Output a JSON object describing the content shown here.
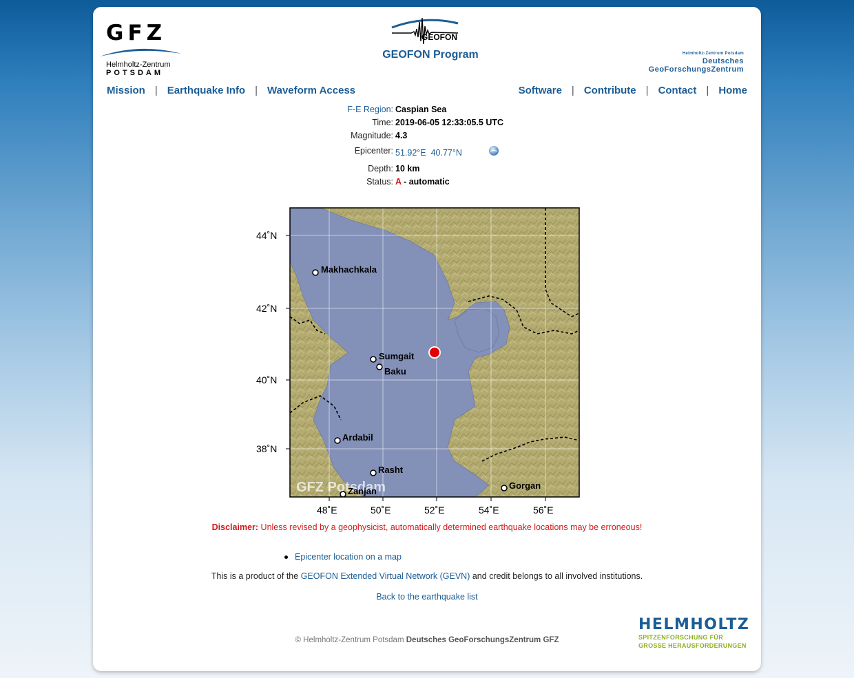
{
  "header": {
    "gfz_letters": "GFZ",
    "gfz_sub1": "Helmholtz-Zentrum",
    "gfz_sub2": "POTSDAM",
    "geofon_word": "GEOFON",
    "program_title": "GEOFON Program",
    "dgfz_line1": "Helmholtz-Zentrum Potsdam",
    "dgfz_line2": "Deutsches",
    "dgfz_line3": "GeoForschungsZentrum"
  },
  "nav": {
    "left": [
      "Mission",
      "Earthquake Info",
      "Waveform Access"
    ],
    "right": [
      "Software",
      "Contribute",
      "Contact",
      "Home"
    ],
    "separator": "|"
  },
  "event": {
    "fe_region_label": "F-E Region:",
    "fe_region": "Caspian Sea",
    "time_label": "Time:",
    "time": "2019-06-05 12:33:05.5 UTC",
    "magnitude_label": "Magnitude:",
    "magnitude": "4.3",
    "epicenter_label": "Epicenter:",
    "epicenter_lon": "51.92°E",
    "epicenter_lat": "40.77°N",
    "depth_label": "Depth:",
    "depth": "10 km",
    "status_label": "Status:",
    "status_code": "A",
    "status_text": "- automatic"
  },
  "map": {
    "lat_labels": [
      "44˚N",
      "42˚N",
      "40˚N",
      "38˚N"
    ],
    "lon_labels": [
      "48˚E",
      "50˚E",
      "52˚E",
      "54˚E",
      "56˚E"
    ],
    "cities": [
      "Makhachkala",
      "Sumgait",
      "Baku",
      "Ardabil",
      "Rasht",
      "Zanjan",
      "Gorgan"
    ],
    "watermark": "GFZ Potsdam",
    "colors": {
      "sea": "#8390b8",
      "land": "#b3ab70",
      "epicenter": "#e00000"
    }
  },
  "disclaimer": {
    "label": "Disclaimer:",
    "text": "Unless revised by a geophysicist, automatically determined earthquake locations may be erroneous!"
  },
  "links": {
    "epicenter_map": "Epicenter location on a map",
    "product_prefix": "This is a product of the",
    "product_link": "GEOFON Extended Virtual Network (GEVN)",
    "product_suffix": "and credit belongs to all involved institutions.",
    "back": "Back to the earthquake list"
  },
  "footer": {
    "copyright_prefix": "© Helmholtz-Zentrum Potsdam",
    "copyright_bold": "Deutsches GeoForschungsZentrum GFZ",
    "helmholtz": "HELMHOLTZ",
    "helmholtz_sub1": "SPITZENFORSCHUNG FÜR",
    "helmholtz_sub2": "GROSSE HERAUSFORDERUNGEN"
  }
}
